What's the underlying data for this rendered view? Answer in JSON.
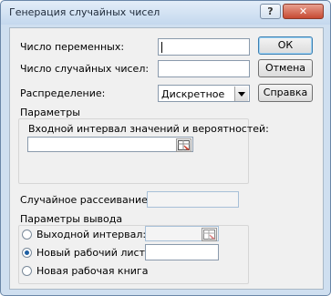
{
  "window": {
    "title": "Генерация случайных чисел"
  },
  "fields": {
    "num_variables_label": "Число переменных:",
    "num_variables_value": "",
    "num_random_label": "Число случайных чисел:",
    "num_random_value": "",
    "distribution_label": "Распределение:",
    "distribution_value": "Дискретное"
  },
  "buttons": {
    "ok": "ОК",
    "cancel": "Отмена",
    "help": "Справка"
  },
  "params": {
    "group_label": "Параметры",
    "interval_label": "Входной интервал значений и вероятностей:",
    "interval_value": ""
  },
  "seed": {
    "label": "Случайное рассеивание:",
    "value": ""
  },
  "output": {
    "group_label": "Параметры вывода",
    "options": [
      {
        "label": "Выходной интервал:",
        "selected": false
      },
      {
        "label": "Новый рабочий лист:",
        "selected": true
      },
      {
        "label": "Новая рабочая книга",
        "selected": false
      }
    ],
    "range_value": "",
    "sheet_value": ""
  }
}
